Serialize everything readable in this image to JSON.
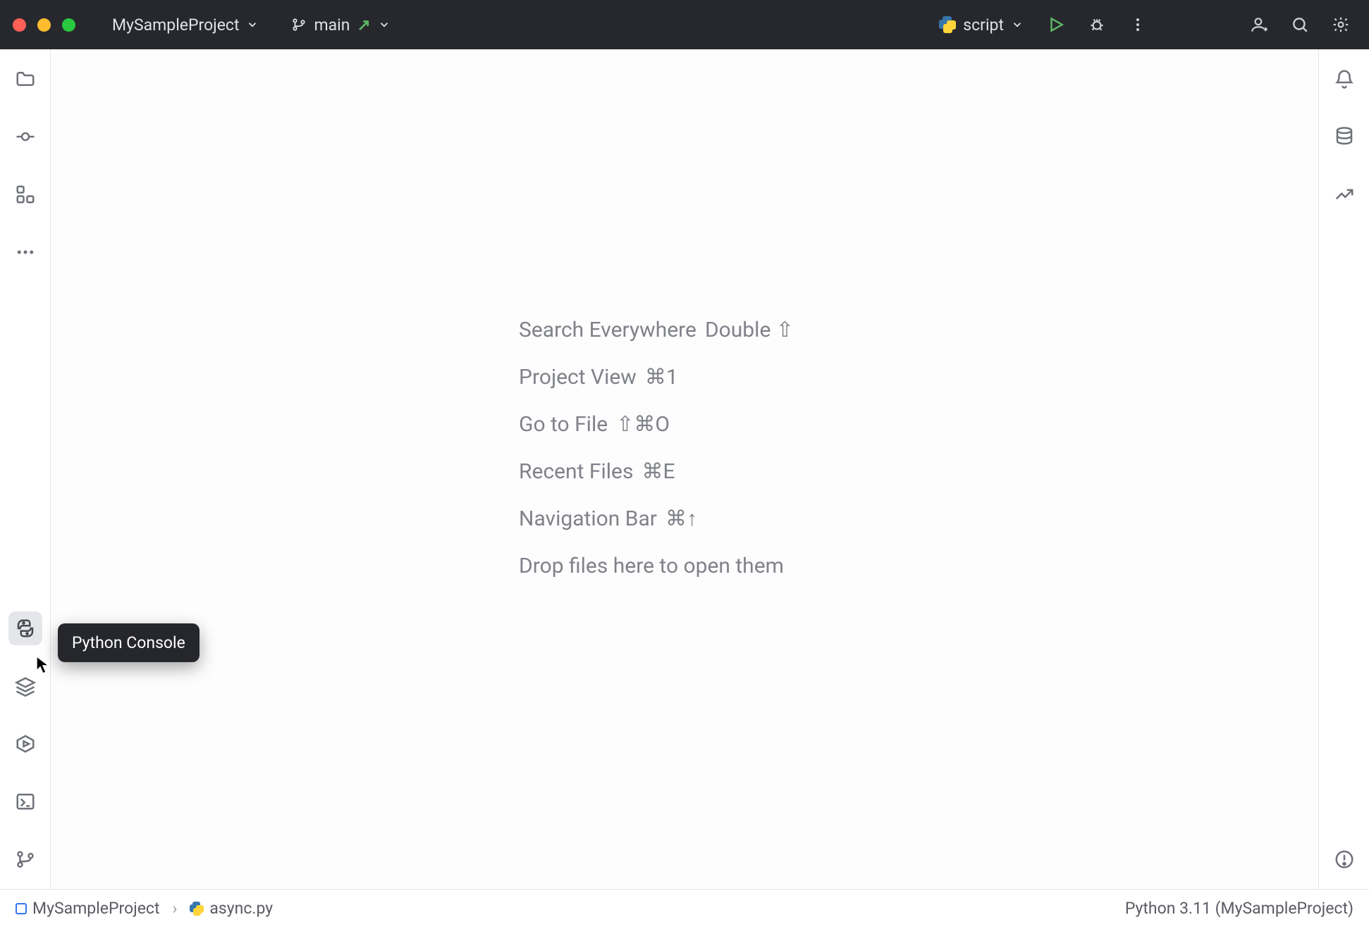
{
  "titlebar": {
    "project_name": "MySampleProject",
    "branch": "main",
    "run_config": "script"
  },
  "left_rail": {
    "top": [
      "project",
      "commit",
      "structure",
      "more"
    ],
    "bottom": [
      "python-console",
      "python-packages",
      "services",
      "terminal",
      "git"
    ]
  },
  "right_rail": [
    "notifications",
    "database",
    "analytics",
    "problems"
  ],
  "tooltip": {
    "label": "Python Console"
  },
  "editor_hints": [
    {
      "label": "Search Everywhere",
      "shortcut": "Double ⇧"
    },
    {
      "label": "Project View",
      "shortcut": "⌘1"
    },
    {
      "label": "Go to File",
      "shortcut": "⇧⌘O"
    },
    {
      "label": "Recent Files",
      "shortcut": "⌘E"
    },
    {
      "label": "Navigation Bar",
      "shortcut": "⌘↑"
    },
    {
      "label": "Drop files here to open them",
      "shortcut": ""
    }
  ],
  "statusbar": {
    "breadcrumb_project": "MySampleProject",
    "breadcrumb_file": "async.py",
    "interpreter": "Python 3.11 (MySampleProject)"
  }
}
